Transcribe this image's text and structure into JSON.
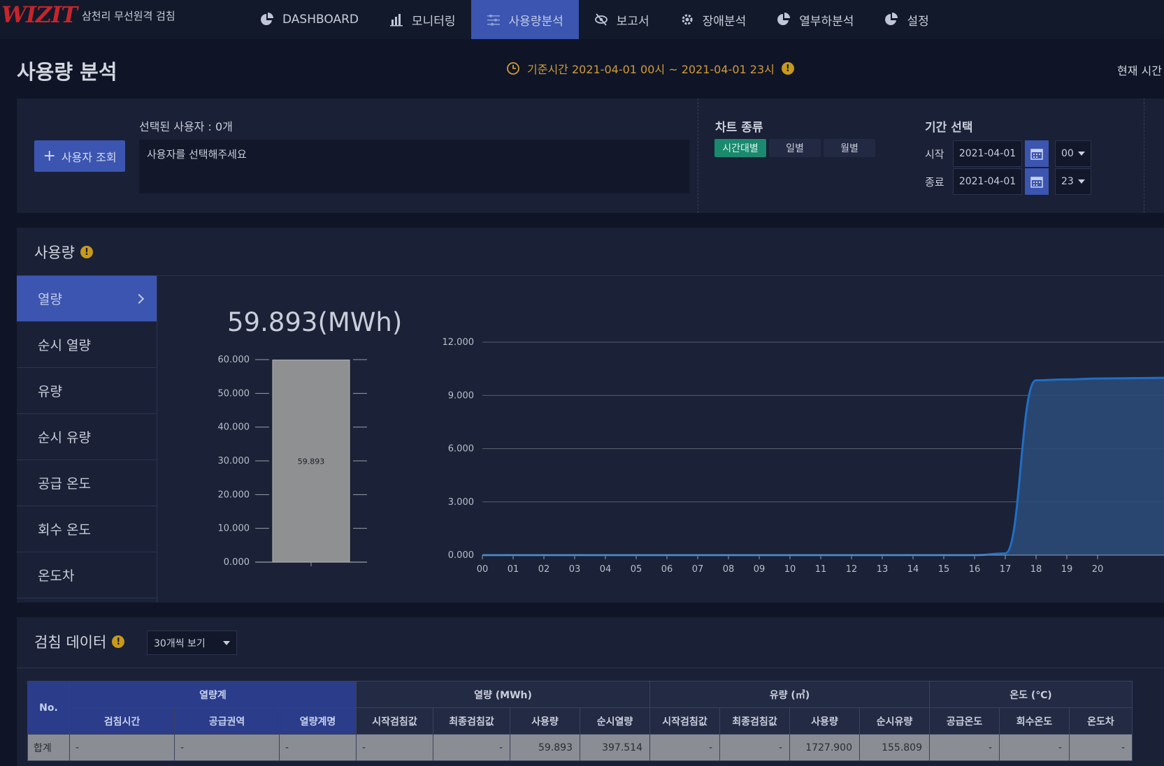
{
  "app": {
    "logo": "WIZIT",
    "subtitle": "삼천리 무선원격 검침"
  },
  "nav": [
    {
      "label": "DASHBOARD",
      "icon": "pie-icon"
    },
    {
      "label": "모니터링",
      "icon": "bar-chart-icon"
    },
    {
      "label": "사용량분석",
      "icon": "sliders-icon",
      "active": true
    },
    {
      "label": "보고서",
      "icon": "eye-off-icon"
    },
    {
      "label": "장애분석",
      "icon": "gear-icon"
    },
    {
      "label": "열부하분석",
      "icon": "pie-icon"
    },
    {
      "label": "설정",
      "icon": "pie-icon"
    }
  ],
  "page": {
    "title": "사용량 분석",
    "ref_time": "기준시간 2021-04-01 00시 ~ 2021-04-01 23시",
    "current_time_label": "현재 시간"
  },
  "filter": {
    "user_button": "사용자 조회",
    "selected_label": "선택된 사용자 : 0개",
    "selected_placeholder": "사용자를 선택해주세요",
    "chart_type_label": "차트 종류",
    "chart_types": [
      "시간대별",
      "일별",
      "월별"
    ],
    "period_label": "기간 선택",
    "start_label": "시작",
    "start_date": "2021-04-01",
    "start_hour": "00",
    "end_label": "종료",
    "end_date": "2021-04-01",
    "end_hour": "23"
  },
  "usage": {
    "title": "사용량",
    "menu": [
      "열량",
      "순시 열량",
      "유량",
      "순시 유량",
      "공급 온도",
      "회수 온도",
      "온도차"
    ],
    "total": "59.893(MWh)"
  },
  "chart_data": [
    {
      "type": "bar",
      "categories": [
        ""
      ],
      "values": [
        59.893
      ],
      "data_labels": [
        "59.893"
      ],
      "ylim": [
        0,
        60
      ],
      "yticks": [
        "0.000",
        "10.000",
        "20.000",
        "30.000",
        "40.000",
        "50.000",
        "60.000"
      ],
      "grid": false,
      "bar_color": "#8f9092"
    },
    {
      "type": "area",
      "x": [
        "00",
        "01",
        "02",
        "03",
        "04",
        "05",
        "06",
        "07",
        "08",
        "09",
        "10",
        "11",
        "12",
        "13",
        "14",
        "15",
        "16",
        "17",
        "18",
        "19",
        "20"
      ],
      "values": [
        0,
        0,
        0,
        0,
        0,
        0,
        0,
        0,
        0,
        0,
        0,
        0,
        0,
        0,
        0,
        0,
        0,
        0.1,
        9.85,
        9.9,
        9.95
      ],
      "ylim": [
        0,
        12
      ],
      "yticks": [
        "0.000",
        "3.000",
        "6.000",
        "9.000",
        "12.000"
      ],
      "grid": true,
      "line_color": "#1f6fc4",
      "fill_color": "#2b4a78"
    }
  ],
  "meter": {
    "title": "검침 데이터",
    "page_size": "30개씩 보기",
    "group_headers": [
      "No.",
      "열량계",
      "열량 (MWh)",
      "유량 (㎥)",
      "온도 (℃)"
    ],
    "columns": [
      "검침시간",
      "공급권역",
      "열량계명",
      "시작검침값",
      "최종검침값",
      "사용량",
      "순시열량",
      "시작검침값",
      "최종검침값",
      "사용량",
      "순시유량",
      "공급온도",
      "회수온도",
      "온도차"
    ],
    "summary_row": [
      "합계",
      "-",
      "-",
      "-",
      "-",
      "-",
      "59.893",
      "397.514",
      "-",
      "-",
      "1727.900",
      "155.809",
      "-",
      "-",
      "-"
    ]
  }
}
